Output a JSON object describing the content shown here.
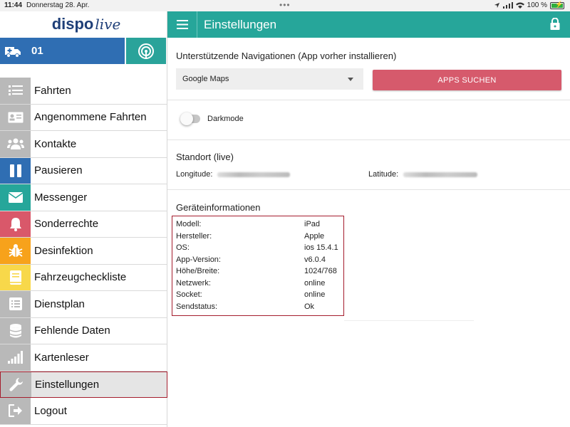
{
  "status": {
    "time": "11:44",
    "date": "Donnerstag 28. Apr.",
    "battery": "100 %"
  },
  "brand": {
    "part1": "dispo",
    "part2": "live"
  },
  "vehicle": {
    "number": "01"
  },
  "sidebar": {
    "items": [
      {
        "label": "Fahrten",
        "icon": "list-icon",
        "color": "gray"
      },
      {
        "label": "Angenommene Fahrten",
        "icon": "id-card-icon",
        "color": "gray"
      },
      {
        "label": "Kontakte",
        "icon": "users-icon",
        "color": "gray"
      },
      {
        "label": "Pausieren",
        "icon": "pause-icon",
        "color": "blue"
      },
      {
        "label": "Messenger",
        "icon": "envelope-icon",
        "color": "teal"
      },
      {
        "label": "Sonderrechte",
        "icon": "bell-icon",
        "color": "red"
      },
      {
        "label": "Desinfektion",
        "icon": "bug-icon",
        "color": "orange"
      },
      {
        "label": "Fahrzeugcheckliste",
        "icon": "book-icon",
        "color": "yellow"
      },
      {
        "label": "Dienstplan",
        "icon": "list-alt-icon",
        "color": "gray"
      },
      {
        "label": "Fehlende Daten",
        "icon": "database-icon",
        "color": "gray"
      },
      {
        "label": "Kartenleser",
        "icon": "signal-icon",
        "color": "gray"
      },
      {
        "label": "Einstellungen",
        "icon": "wrench-icon",
        "color": "gray"
      },
      {
        "label": "Logout",
        "icon": "logout-icon",
        "color": "gray"
      }
    ],
    "active_index": 11
  },
  "header": {
    "title": "Einstellungen"
  },
  "navigation": {
    "title": "Unterstützende Navigationen (App vorher installieren)",
    "selected": "Google Maps",
    "button": "APPS SUCHEN"
  },
  "darkmode": {
    "label": "Darkmode",
    "enabled": false
  },
  "location": {
    "title": "Standort (live)",
    "longitude_label": "Longitude:",
    "latitude_label": "Latitude:"
  },
  "device": {
    "title": "Geräteinformationen",
    "rows": [
      {
        "k": "Modell:",
        "v": "iPad"
      },
      {
        "k": "Hersteller:",
        "v": "Apple"
      },
      {
        "k": "OS:",
        "v": "ios 15.4.1"
      },
      {
        "k": "App-Version:",
        "v": "v6.0.4"
      },
      {
        "k": "Höhe/Breite:",
        "v": "1024/768"
      },
      {
        "k": "Netzwerk:",
        "v": "online"
      },
      {
        "k": "Socket:",
        "v": "online"
      },
      {
        "k": "Sendstatus:",
        "v": "Ok"
      }
    ]
  },
  "colors": {
    "primary": "#26a69a",
    "vehicle_blue": "#2f6eb3",
    "danger": "#d65a6c"
  }
}
